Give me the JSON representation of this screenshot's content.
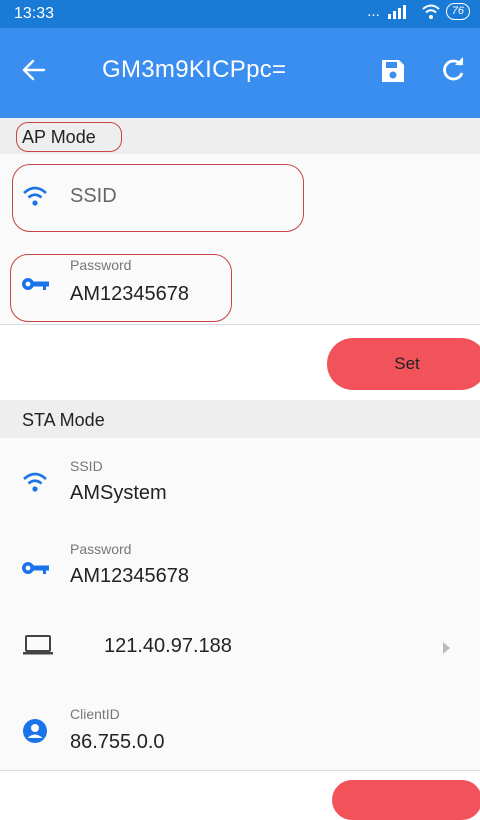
{
  "status": {
    "time": "13:33",
    "dots": "...",
    "battery": "76"
  },
  "appbar": {
    "title": "GM3m9KICPpc=",
    "back_icon": "arrow-back-icon",
    "save_icon": "floppy-save-icon",
    "refresh_icon": "refresh-icon"
  },
  "ap_mode": {
    "header": "AP Mode",
    "ssid_placeholder": "SSID",
    "password_caption": "Password",
    "password_value": "AM12345678",
    "set_label": "Set"
  },
  "sta_mode": {
    "header": "STA Mode",
    "ssid_caption": "SSID",
    "ssid_value": "AMSystem",
    "password_caption": "Password",
    "password_value": "AM12345678",
    "server_value": "121.40.97.188",
    "client_caption": "ClientID",
    "client_value": "86.755.0.0"
  },
  "colors": {
    "appbar": "#3a8ef0",
    "statusbar": "#1a7bd6",
    "accent": "#1a73e8",
    "button": "#f2525a",
    "annotation": "#c94444"
  }
}
